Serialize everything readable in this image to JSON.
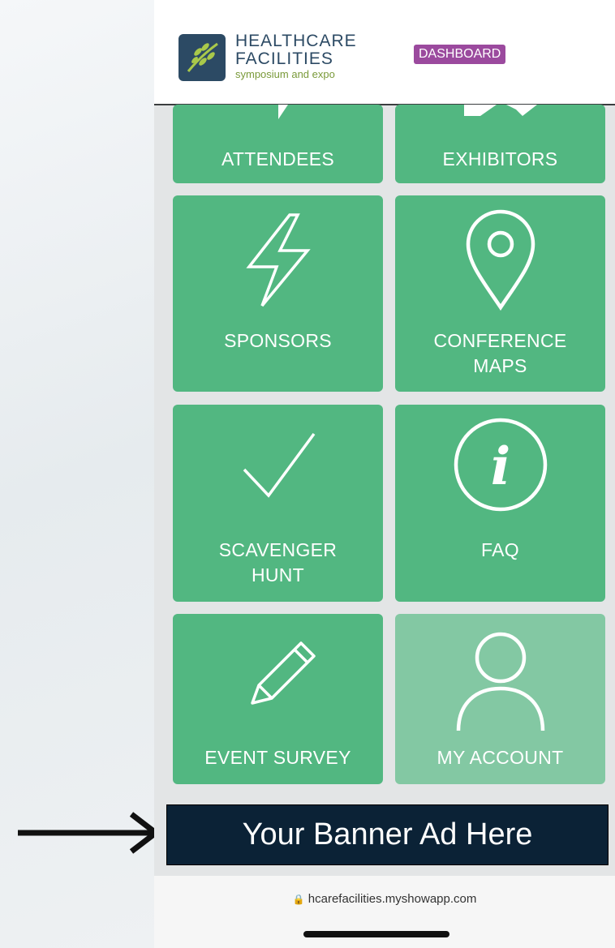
{
  "header": {
    "logo_line1": "HEALTHCARE",
    "logo_line2": "FACILITIES",
    "logo_line3": "symposium and expo",
    "dashboard_label": "DASHBOARD"
  },
  "tiles": [
    {
      "label": "ATTENDEES",
      "icon": "attendees-icon"
    },
    {
      "label": "EXHIBITORS",
      "icon": "exhibitors-icon"
    },
    {
      "label": "SPONSORS",
      "icon": "lightning-icon"
    },
    {
      "label": "CONFERENCE MAPS",
      "icon": "map-pin-icon"
    },
    {
      "label": "SCAVENGER HUNT",
      "icon": "checkmark-icon"
    },
    {
      "label": "FAQ",
      "icon": "info-icon"
    },
    {
      "label": "EVENT SURVEY",
      "icon": "pencil-icon"
    },
    {
      "label": "MY ACCOUNT",
      "icon": "user-icon"
    }
  ],
  "banner": {
    "text": "Your Banner Ad Here"
  },
  "browser": {
    "url": "hcarefacilities.myshowapp.com"
  },
  "colors": {
    "tile_green": "#52b781",
    "tile_green_light": "#83c8a3",
    "dashboard_purple": "#9b4a9e",
    "banner_navy": "#0b2236",
    "logo_navy": "#2c4a64"
  }
}
